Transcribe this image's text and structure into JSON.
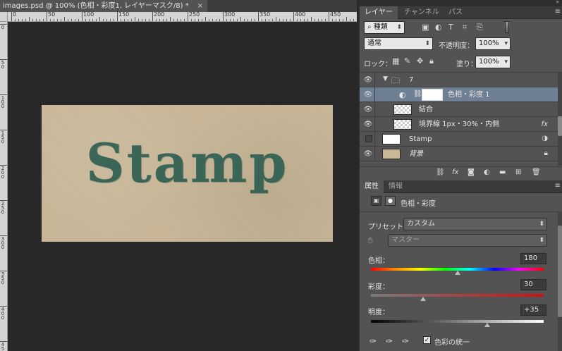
{
  "document": {
    "tab_title": "images.psd @ 100% (色相・彩度1, レイヤーマスク/8) *",
    "ruler_top_labels": [
      "0",
      "50",
      "100",
      "150",
      "200",
      "250",
      "300",
      "350",
      "400",
      "450"
    ],
    "ruler_left_labels": [
      "0",
      "5 0",
      "1 0 0",
      "1 5 0",
      "2 0 0",
      "2 5 0",
      "3 0 0",
      "3 5 0",
      "4 0 0",
      "4 5 0"
    ],
    "artwork_text": "Stamp"
  },
  "layers_panel": {
    "tabs": [
      {
        "label": "レイヤー",
        "active": true
      },
      {
        "label": "チャンネル",
        "active": false
      },
      {
        "label": "パス",
        "active": false
      }
    ],
    "filter_kind": "種類",
    "blend_mode": "通常",
    "opacity_label": "不透明度：",
    "opacity_value": "100%",
    "lock_label": "ロック：",
    "fill_label": "塗り：",
    "fill_value": "100%",
    "layers": [
      {
        "name": "7",
        "type": "group"
      },
      {
        "name": "色相・彩度 1",
        "type": "adjustment",
        "selected": true
      },
      {
        "name": "結合",
        "type": "pixel"
      },
      {
        "name": "境界線 1px・30%・内側",
        "type": "pixel",
        "fx": "fx"
      },
      {
        "name": "Stamp",
        "type": "smart"
      },
      {
        "name": "背景",
        "type": "background"
      }
    ]
  },
  "properties_panel": {
    "tabs": [
      {
        "label": "属性",
        "active": true
      },
      {
        "label": "情報",
        "active": false
      }
    ],
    "title": "色相・彩度",
    "preset_label": "プリセット：",
    "preset_value": "カスタム",
    "channel_value": "マスター",
    "hue_label": "色相：",
    "hue_value": "180",
    "saturation_label": "彩度：",
    "saturation_value": "30",
    "lightness_label": "明度：",
    "lightness_value": "+35",
    "hue_position": 0.5,
    "saturation_position": 0.3,
    "lightness_position": 0.675,
    "colorize_label": "色彩の統一",
    "colorize_checked": true
  }
}
